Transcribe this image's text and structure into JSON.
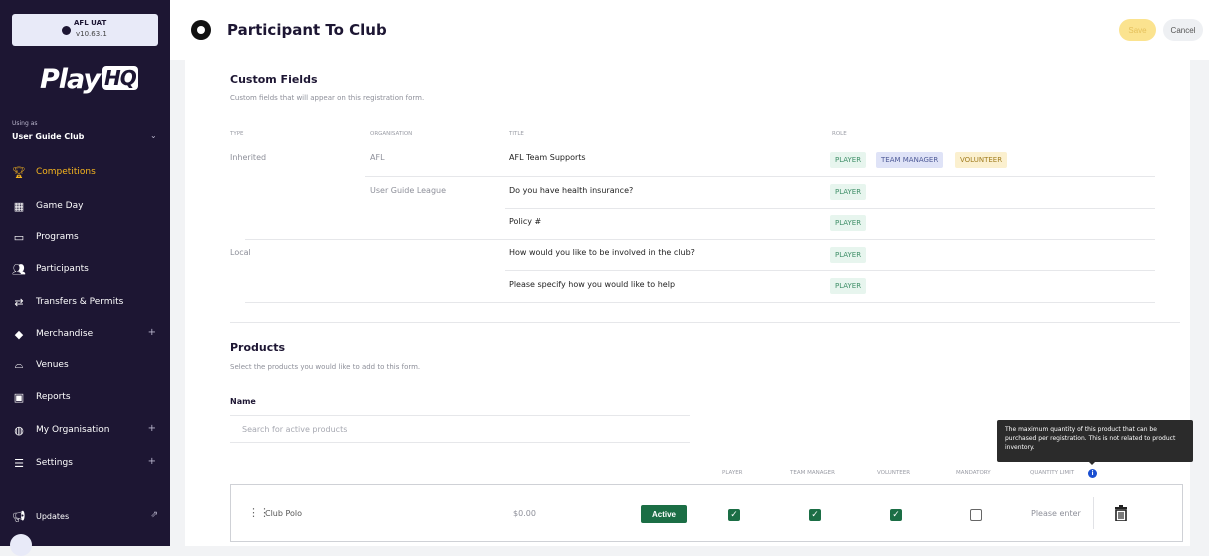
{
  "env": {
    "name": "AFL UAT",
    "version": "v10.63.1"
  },
  "logo": {
    "text": "Play",
    "badge": "HQ"
  },
  "org": {
    "using_label": "Using as",
    "club": "User Guide Club"
  },
  "nav": [
    {
      "label": "Competitions",
      "icon": "trophy-icon",
      "active": true,
      "plus": false
    },
    {
      "label": "Game Day",
      "icon": "scoreboard-icon",
      "active": false,
      "plus": false
    },
    {
      "label": "Programs",
      "icon": "book-icon",
      "active": false,
      "plus": false
    },
    {
      "label": "Participants",
      "icon": "people-icon",
      "active": false,
      "plus": false
    },
    {
      "label": "Transfers & Permits",
      "icon": "transfer-icon",
      "active": false,
      "plus": false
    },
    {
      "label": "Merchandise",
      "icon": "shirt-icon",
      "active": false,
      "plus": true
    },
    {
      "label": "Venues",
      "icon": "stadium-icon",
      "active": false,
      "plus": false
    },
    {
      "label": "Reports",
      "icon": "report-icon",
      "active": false,
      "plus": false
    },
    {
      "label": "My Organisation",
      "icon": "globe-icon",
      "active": false,
      "plus": true
    },
    {
      "label": "Settings",
      "icon": "sliders-icon",
      "active": false,
      "plus": true
    }
  ],
  "updates": {
    "label": "Updates"
  },
  "header": {
    "title": "Participant To Club",
    "save_label": "Save",
    "cancel_label": "Cancel"
  },
  "custom_fields": {
    "title": "Custom Fields",
    "description": "Custom fields that will appear on this registration form.",
    "columns": {
      "type": "TYPE",
      "organisation": "ORGANISATION",
      "title": "TITLE",
      "role": "ROLE"
    },
    "rows": [
      {
        "type": "Inherited",
        "organisation": "AFL",
        "title": "AFL Team Supports",
        "roles": [
          "PLAYER",
          "TEAM MANAGER",
          "VOLUNTEER"
        ]
      },
      {
        "type": "",
        "organisation": "User Guide League",
        "title": "Do you have health insurance?",
        "roles": [
          "PLAYER"
        ]
      },
      {
        "type": "",
        "organisation": "",
        "title": "Policy #",
        "roles": [
          "PLAYER"
        ]
      },
      {
        "type": "Local",
        "organisation": "",
        "title": "How would you like to be involved in the club?",
        "roles": [
          "PLAYER"
        ]
      },
      {
        "type": "",
        "organisation": "",
        "title": "Please specify how you would like to help",
        "roles": [
          "PLAYER"
        ]
      }
    ]
  },
  "products": {
    "title": "Products",
    "description": "Select the products you would like to add to this form.",
    "name_label": "Name",
    "search_placeholder": "Search for active products",
    "tooltip": "The maximum quantity of this product that can be purchased per registration. This is not related to product inventory.",
    "columns": {
      "player": "PLAYER",
      "team_manager": "TEAM MANAGER",
      "volunteer": "VOLUNTEER",
      "mandatory": "MANDATORY",
      "quantity_limit": "QUANTITY LIMIT"
    },
    "items": [
      {
        "name": "Club Polo",
        "price": "$0.00",
        "status": "Active",
        "player": true,
        "team_manager": true,
        "volunteer": true,
        "mandatory": false,
        "quantity_placeholder": "Please enter"
      }
    ]
  }
}
